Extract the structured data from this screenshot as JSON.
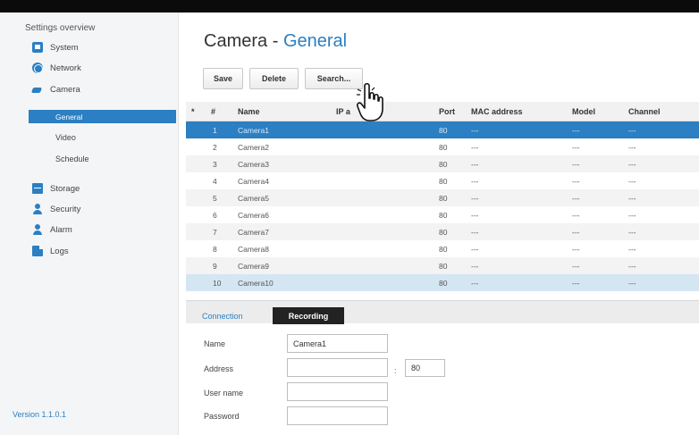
{
  "sidebar": {
    "title": "Settings overview",
    "items": [
      {
        "label": "System",
        "icon": "system-icon"
      },
      {
        "label": "Network",
        "icon": "network-icon"
      },
      {
        "label": "Camera",
        "icon": "camera-icon"
      },
      {
        "label": "Storage",
        "icon": "storage-icon"
      },
      {
        "label": "Security",
        "icon": "person-icon"
      },
      {
        "label": "Alarm",
        "icon": "person-icon"
      },
      {
        "label": "Logs",
        "icon": "logs-icon"
      }
    ],
    "camera_subitems": [
      "General",
      "Video",
      "Schedule"
    ],
    "active_subitem": "General",
    "version": "Version 1.1.0.1"
  },
  "page": {
    "title": "Camera",
    "separator": "-",
    "subtitle": "General"
  },
  "toolbar": {
    "save_label": "Save",
    "delete_label": "Delete",
    "search_label": "Search..."
  },
  "table": {
    "columns": [
      "*",
      "#",
      "Name",
      "IP a",
      "Port",
      "MAC address",
      "Model",
      "Channel"
    ],
    "rows": [
      {
        "num": "1",
        "name": "Camera1",
        "port": "80",
        "mac": "---",
        "model": "---",
        "channel": "---"
      },
      {
        "num": "2",
        "name": "Camera2",
        "port": "80",
        "mac": "---",
        "model": "---",
        "channel": "---"
      },
      {
        "num": "3",
        "name": "Camera3",
        "port": "80",
        "mac": "---",
        "model": "---",
        "channel": "---"
      },
      {
        "num": "4",
        "name": "Camera4",
        "port": "80",
        "mac": "---",
        "model": "---",
        "channel": "---"
      },
      {
        "num": "5",
        "name": "Camera5",
        "port": "80",
        "mac": "---",
        "model": "---",
        "channel": "---"
      },
      {
        "num": "6",
        "name": "Camera6",
        "port": "80",
        "mac": "---",
        "model": "---",
        "channel": "---"
      },
      {
        "num": "7",
        "name": "Camera7",
        "port": "80",
        "mac": "---",
        "model": "---",
        "channel": "---"
      },
      {
        "num": "8",
        "name": "Camera8",
        "port": "80",
        "mac": "---",
        "model": "---",
        "channel": "---"
      },
      {
        "num": "9",
        "name": "Camera9",
        "port": "80",
        "mac": "---",
        "model": "---",
        "channel": "---"
      },
      {
        "num": "10",
        "name": "Camera10",
        "port": "80",
        "mac": "---",
        "model": "---",
        "channel": "---"
      }
    ],
    "selected_row": "1",
    "hover_row": "10"
  },
  "tabs": {
    "connection": "Connection",
    "recording": "Recording"
  },
  "form": {
    "name_label": "Name",
    "name_value": "Camera1",
    "address_label": "Address",
    "address_value": "",
    "colon": ":",
    "port_value": "80",
    "username_label": "User name",
    "username_value": "",
    "password_label": "Password",
    "password_value": ""
  },
  "colors": {
    "accent": "#2b7fc2",
    "selected_row": "#2b7fc2",
    "hover_row": "#d5e6f3",
    "active_tab": "#222222"
  },
  "cursor": "hand-pointer-icon"
}
